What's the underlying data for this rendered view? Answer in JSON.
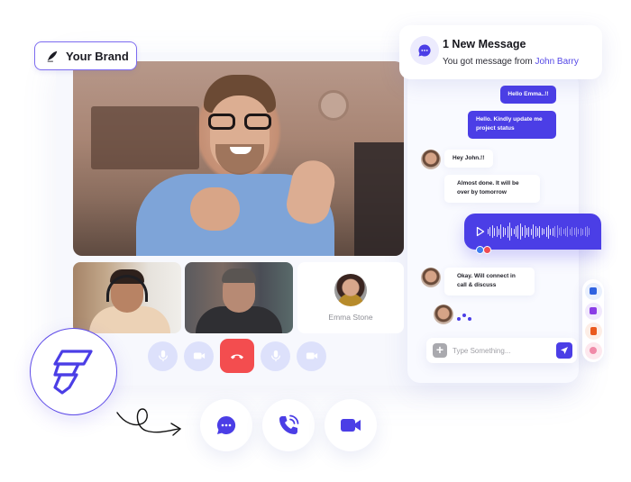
{
  "brand": {
    "label": "Your Brand",
    "icon": "feather-pen-icon"
  },
  "notification": {
    "icon": "chat-bubble-icon",
    "title": "1 New Message",
    "body_prefix": "You got message from",
    "sender": "John Barry"
  },
  "call": {
    "main_participant": "main-speaker",
    "tiles": [
      {
        "name": "participant-headset"
      },
      {
        "name": "participant-gray-hair"
      },
      {
        "name": "Emma Stone"
      }
    ],
    "controls": [
      "mic-icon",
      "camera-icon",
      "end-call-icon",
      "mic-icon",
      "camera-icon"
    ]
  },
  "chat": {
    "messages": [
      {
        "direction": "out",
        "text": "Hello Emma..!!"
      },
      {
        "direction": "out",
        "text": "Hello. Kindly update me project status"
      },
      {
        "direction": "in",
        "text": "Hey John.!!"
      },
      {
        "direction": "in",
        "text": "Almost done. It will be over by tomorrow"
      },
      {
        "direction": "out",
        "type": "voice",
        "reactions": [
          "like",
          "love"
        ]
      },
      {
        "direction": "in",
        "text": "Okay. Will connect in call & discuss"
      },
      {
        "direction": "in",
        "type": "typing"
      }
    ],
    "composer": {
      "placeholder": "Type Something...",
      "value": ""
    },
    "tools": [
      "image-icon",
      "video-file-icon",
      "document-icon",
      "audio-icon"
    ]
  },
  "actions": [
    "chat-icon",
    "phone-call-icon",
    "video-camera-icon"
  ],
  "colors": {
    "accent": "#4b3ee6",
    "end_call": "#f34d4f",
    "control_bg": "#dde1fb"
  }
}
